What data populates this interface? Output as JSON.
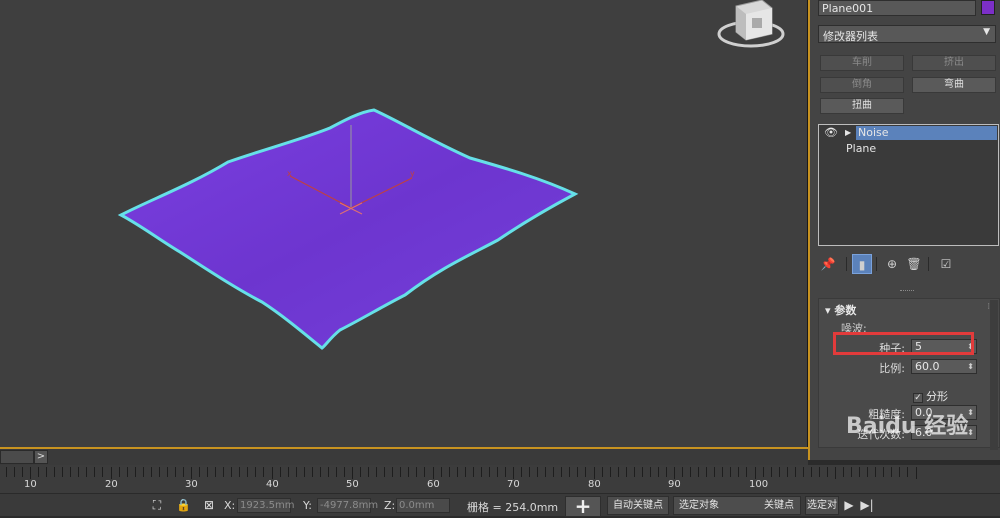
{
  "viewport": {
    "label": "Perspective viewport",
    "plane_color": "#7a3fd8",
    "outline_color": "#66e0e8"
  },
  "panel": {
    "object_name": "Plane001",
    "object_color": "#7c2fc8",
    "modifier_list": "修改器列表",
    "buttons": {
      "lathe": "车削",
      "extrude": "挤出",
      "chamfer": "倒角",
      "bend": "弯曲",
      "twist": "扭曲"
    },
    "stack": {
      "items": [
        "Noise",
        "Plane"
      ]
    },
    "rollout": {
      "title": "参数",
      "group": "噪波:",
      "seed_label": "种子:",
      "seed_value": "5",
      "scale_label": "比例:",
      "scale_value": "60.0",
      "fractal_label": "分形",
      "fractal_checked": true,
      "roughness_label": "粗糙度:",
      "roughness_value": "0.0",
      "iterations_label": "迭代次数:",
      "iterations_value": "6.0"
    }
  },
  "timeline": {
    "nav_label": ">",
    "ticks": [
      "10",
      "20",
      "30",
      "40",
      "50",
      "60",
      "70",
      "80",
      "90",
      "100"
    ]
  },
  "status": {
    "x_label": "X:",
    "x_value": "1923.5mm",
    "y_label": "Y:",
    "y_value": "-4977.8mm",
    "z_label": "Z:",
    "z_value": "0.0mm",
    "grid": "栅格 = 254.0mm",
    "auto_key": "自动关键点",
    "selected_object": "选定对象",
    "key_point": "关键点",
    "filter": "选定对"
  },
  "watermark": "Baidu 经验"
}
